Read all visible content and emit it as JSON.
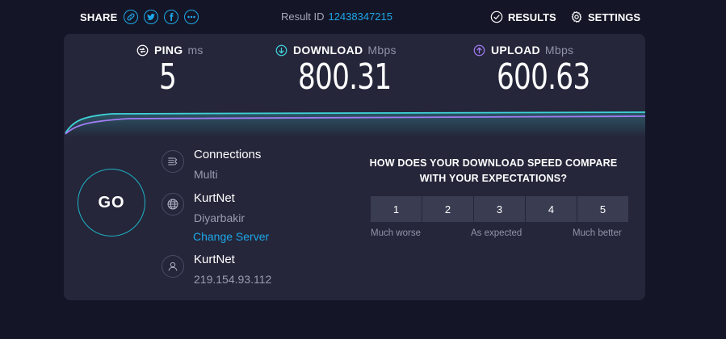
{
  "share": {
    "label": "SHARE"
  },
  "result": {
    "label": "Result ID",
    "id": "12438347215"
  },
  "nav": {
    "results": "RESULTS",
    "settings": "SETTINGS"
  },
  "metrics": {
    "ping": {
      "label": "PING",
      "unit": "ms",
      "value": "5"
    },
    "download": {
      "label": "DOWNLOAD",
      "unit": "Mbps",
      "value": "800.31"
    },
    "upload": {
      "label": "UPLOAD",
      "unit": "Mbps",
      "value": "600.63"
    }
  },
  "go": {
    "label": "GO"
  },
  "connections": {
    "title": "Connections",
    "value": "Multi"
  },
  "server": {
    "name": "KurtNet",
    "location": "Diyarbakir",
    "change_link": "Change Server"
  },
  "provider": {
    "name": "KurtNet",
    "ip": "219.154.93.112"
  },
  "survey": {
    "question_line1": "HOW DOES YOUR DOWNLOAD SPEED COMPARE",
    "question_line2": "WITH YOUR EXPECTATIONS?",
    "options": [
      "1",
      "2",
      "3",
      "4",
      "5"
    ],
    "low_label": "Much worse",
    "mid_label": "As expected",
    "high_label": "Much better"
  },
  "colors": {
    "accent": "#1ea7e8",
    "download": "#3fd3d9",
    "upload": "#a07cf2",
    "panel": "#25263a",
    "background": "#141526"
  },
  "icons": [
    "link-icon",
    "twitter-icon",
    "facebook-icon",
    "more-icon",
    "check-circle-icon",
    "gear-icon",
    "ping-icon",
    "download-arrow-icon",
    "upload-arrow-icon",
    "connections-icon",
    "globe-icon",
    "user-icon"
  ]
}
